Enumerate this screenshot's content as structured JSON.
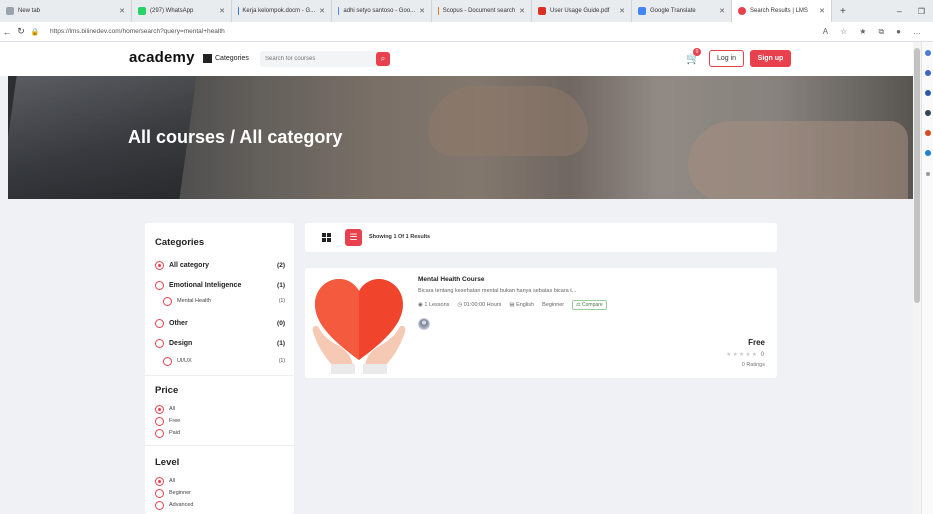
{
  "browser": {
    "tabs": [
      {
        "label": "New tab",
        "color": "#9aa3ad"
      },
      {
        "label": "(297) WhatsApp",
        "color": "#25d366"
      },
      {
        "label": "Kerja kelompok.docm - G...",
        "color": "#2b7cd3"
      },
      {
        "label": "adhi setyo santoso - Goo...",
        "color": "#4285f4"
      },
      {
        "label": "Scopus - Document search",
        "color": "#e9711c"
      },
      {
        "label": "User Usage Guide.pdf",
        "color": "#d93025"
      },
      {
        "label": "Google Translate",
        "color": "#4285f4"
      },
      {
        "label": "Search Results | LMS",
        "color": "#e8404c"
      }
    ],
    "url": "https://lms.bilinedev.com/home/search?query=mental+health"
  },
  "header": {
    "logo": "academy",
    "categories_label": "Categories",
    "search_placeholder": "Search for courses",
    "cart_count": "0",
    "login_label": "Log in",
    "signup_label": "Sign up"
  },
  "hero": {
    "title": "All courses / All category"
  },
  "sidebar": {
    "categories_title": "Categories",
    "categories": [
      {
        "label": "All category",
        "count": "(2)",
        "selected": true
      },
      {
        "label": "Emotional Inteligence",
        "count": "(1)",
        "selected": false
      },
      {
        "label": "Mental Health",
        "count": "(1)",
        "selected": false
      },
      {
        "label": "Other",
        "count": "(0)",
        "selected": false
      },
      {
        "label": "Design",
        "count": "(1)",
        "selected": false
      },
      {
        "label": "UI/UX",
        "count": "(1)",
        "selected": false
      }
    ],
    "price_title": "Price",
    "price_options": [
      {
        "label": "All",
        "selected": true
      },
      {
        "label": "Free",
        "selected": false
      },
      {
        "label": "Paid",
        "selected": false
      }
    ],
    "level_title": "Level",
    "level_options": [
      {
        "label": "All",
        "selected": true
      },
      {
        "label": "Beginner",
        "selected": false
      },
      {
        "label": "Advanced",
        "selected": false
      }
    ]
  },
  "results": {
    "showing": "Showing 1 Of 1 Results"
  },
  "course": {
    "title": "Mental Health Course",
    "description": "Bicara tentang kesehatan mental bukan hanya sebatas bicara t...",
    "lessons": "1 Lessons",
    "duration": "01:00:00 Hours",
    "language": "English",
    "level": "Beginner",
    "compare_label": "Compare",
    "price": "Free",
    "rating_value": "0",
    "ratings_label": "0 Ratings"
  },
  "colors": {
    "accent": "#e8404c"
  }
}
